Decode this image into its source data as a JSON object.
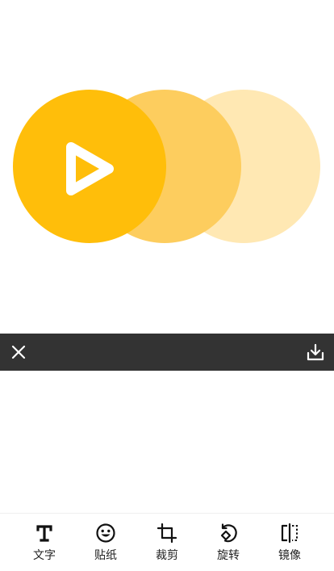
{
  "canvas": {
    "logo_colors": {
      "primary": "#FFBE0A",
      "middle": "#FDCD5E",
      "light": "#FFE8B3",
      "play": "#FFFFFF"
    }
  },
  "action_bar": {
    "background": "#333333",
    "close_icon": "close-icon",
    "save_icon": "download-icon"
  },
  "toolbar": {
    "items": [
      {
        "label": "文字",
        "icon": "text-icon"
      },
      {
        "label": "贴纸",
        "icon": "sticker-icon"
      },
      {
        "label": "裁剪",
        "icon": "crop-icon"
      },
      {
        "label": "旋转",
        "icon": "rotate-icon"
      },
      {
        "label": "镜像",
        "icon": "mirror-icon"
      }
    ]
  }
}
